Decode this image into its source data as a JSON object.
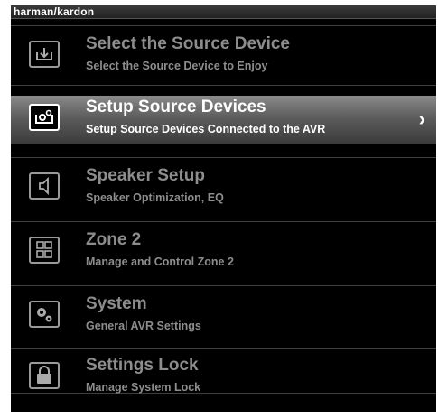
{
  "brand": {
    "name": "harman/kardon"
  },
  "menu": {
    "items": [
      {
        "title": "Select the Source Device",
        "subtitle": "Select the Source Device to Enjoy",
        "icon": "input-arrow-icon",
        "selected": false
      },
      {
        "title": "Setup Source Devices",
        "subtitle": "Setup Source Devices Connected to the AVR",
        "icon": "source-setup-icon",
        "selected": true
      },
      {
        "title": "Speaker Setup",
        "subtitle": "Speaker Optimization, EQ",
        "icon": "speaker-icon",
        "selected": false
      },
      {
        "title": "Zone 2",
        "subtitle": "Manage and Control Zone 2",
        "icon": "zone-grid-icon",
        "selected": false
      },
      {
        "title": "System",
        "subtitle": "General AVR Settings",
        "icon": "gears-icon",
        "selected": false
      },
      {
        "title": "Settings Lock",
        "subtitle": "Manage System Lock",
        "icon": "lock-icon",
        "selected": false
      }
    ],
    "selected_chevron": "›"
  },
  "colors": {
    "background": "#000000",
    "text": "#8d8d8d",
    "selected_text": "#ffffff"
  }
}
